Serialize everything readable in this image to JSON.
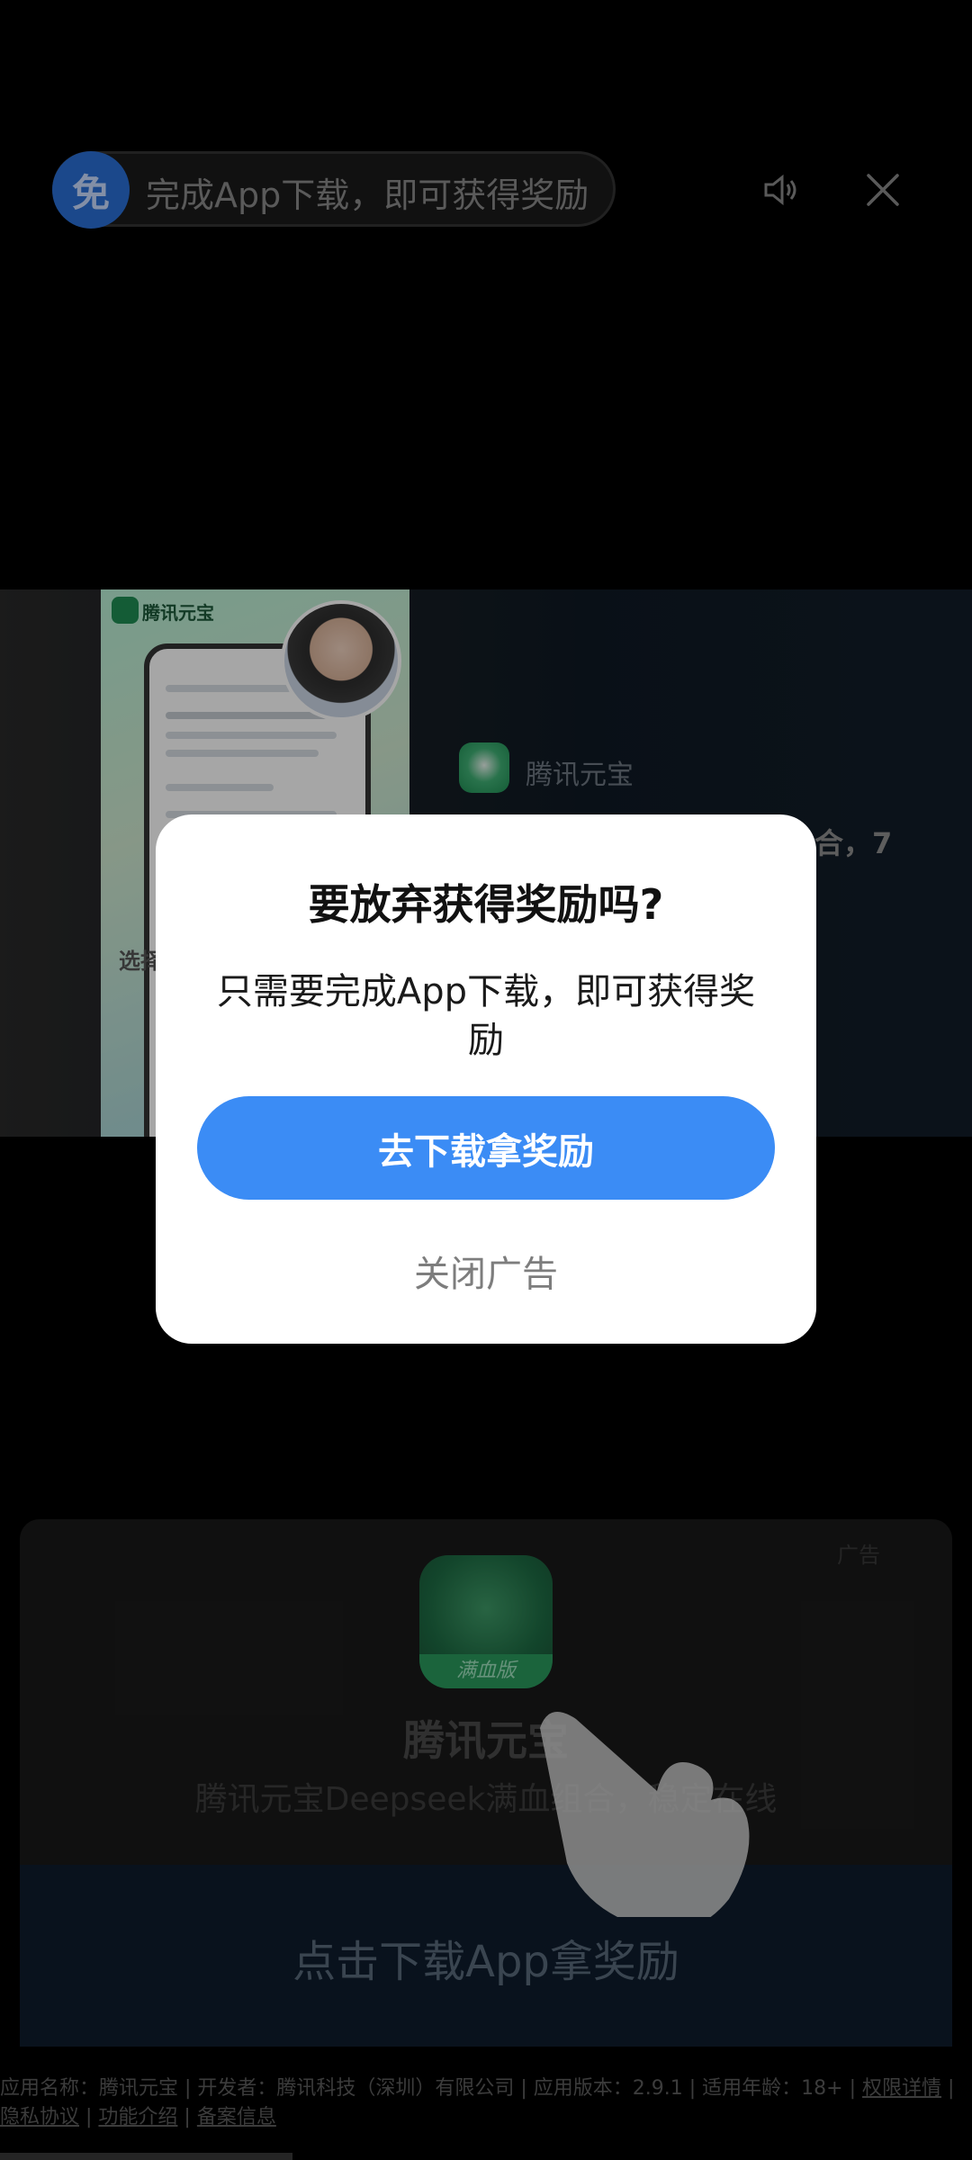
{
  "topbar": {
    "free_badge": "免",
    "reward_text": "完成App下载，即可获得奖励",
    "sound_icon": "speaker-icon",
    "close_icon": "close-icon"
  },
  "video": {
    "app_name": "腾讯元宝",
    "brand_small": "腾讯元宝",
    "overlay_text": "合，7",
    "left_text": "选择"
  },
  "ad_card": {
    "tag": "广告",
    "icon_band": "满血版",
    "title": "腾讯元宝",
    "description": "腾讯元宝Deepseek满血组合，稳定在线",
    "cta": "点击下载App拿奖励"
  },
  "footer": {
    "line1": "应用名称：腾讯元宝 | 开发者：腾讯科技（深圳）有限公司 | 应用版本：2.9.1 | 适用年龄：18+ | ",
    "permissions": "权限详情",
    "privacy": "隐私协议",
    "features": "功能介绍",
    "filing": "备案信息",
    "sep": " | "
  },
  "modal": {
    "title": "要放弃获得奖励吗?",
    "message": "只需要完成App下载，即可获得奖励",
    "primary_button": "去下载拿奖励",
    "secondary_button": "关闭广告"
  },
  "colors": {
    "primary": "#3b8cf5",
    "modal_bg": "#ffffff",
    "badge": "#2a6fd6"
  }
}
